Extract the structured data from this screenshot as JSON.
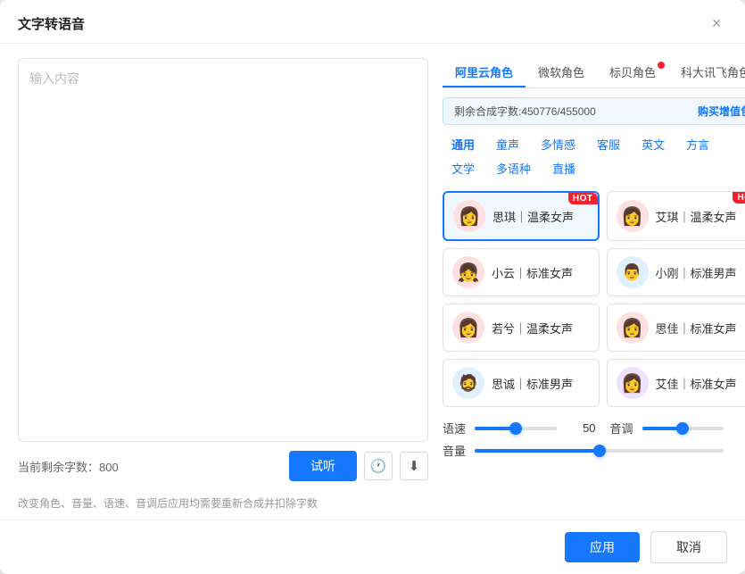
{
  "dialog": {
    "title": "文字转语音",
    "close_label": "×"
  },
  "left": {
    "textarea_placeholder": "输入内容",
    "char_count_label": "当前剩余字数：",
    "char_count_value": "800",
    "btn_audition": "试听"
  },
  "right": {
    "provider_tabs": [
      {
        "label": "阿里云角色",
        "active": true,
        "badge": false
      },
      {
        "label": "微软角色",
        "active": false,
        "badge": false
      },
      {
        "label": "标贝角色",
        "active": false,
        "badge": true
      },
      {
        "label": "科大讯飞角色",
        "active": false,
        "badge": false
      }
    ],
    "info_bar": {
      "text": "剩余合成字数:450776/455000",
      "buy_label": "购买增值包"
    },
    "category_tabs": [
      {
        "label": "通用",
        "active": true
      },
      {
        "label": "童声",
        "active": false
      },
      {
        "label": "多情感",
        "active": false
      },
      {
        "label": "客服",
        "active": false
      },
      {
        "label": "英文",
        "active": false
      },
      {
        "label": "方言",
        "active": false
      },
      {
        "label": "文学",
        "active": false
      },
      {
        "label": "多语种",
        "active": false
      },
      {
        "label": "直播",
        "active": false
      }
    ],
    "voices": [
      {
        "name": "思琪｜温柔女声",
        "avatar": "👩",
        "avatar_bg": "pink-bg",
        "hot": true,
        "selected": true
      },
      {
        "name": "艾琪｜温柔女声",
        "avatar": "👩",
        "avatar_bg": "pink-bg",
        "hot": true,
        "selected": false
      },
      {
        "name": "小云｜标准女声",
        "avatar": "👧",
        "avatar_bg": "pink-bg",
        "hot": false,
        "selected": false
      },
      {
        "name": "小刚｜标准男声",
        "avatar": "🧑",
        "avatar_bg": "blue-bg",
        "hot": false,
        "selected": false
      },
      {
        "name": "若兮｜温柔女声",
        "avatar": "👩",
        "avatar_bg": "pink-bg",
        "hot": false,
        "selected": false
      },
      {
        "name": "思佳｜标准女声",
        "avatar": "👩",
        "avatar_bg": "pink-bg",
        "hot": false,
        "selected": false
      },
      {
        "name": "思诚｜标准男声",
        "avatar": "🧔",
        "avatar_bg": "blue-bg",
        "hot": false,
        "selected": false
      },
      {
        "name": "艾佳｜标准女声",
        "avatar": "👩",
        "avatar_bg": "purple-bg",
        "hot": false,
        "selected": false
      }
    ],
    "sliders": [
      {
        "label": "语速",
        "value": 50.0,
        "percent": 50
      },
      {
        "label": "音调",
        "value": 50.0,
        "percent": 50
      },
      {
        "label": "音量",
        "value": 50.0,
        "percent": 50
      }
    ]
  },
  "footer": {
    "note": "改变角色、音量、语速、音调后应用均需要重新合成并扣除字数",
    "btn_apply": "应用",
    "btn_cancel": "取消"
  },
  "icons": {
    "close": "✕",
    "history": "🕐",
    "download": "⬇"
  }
}
